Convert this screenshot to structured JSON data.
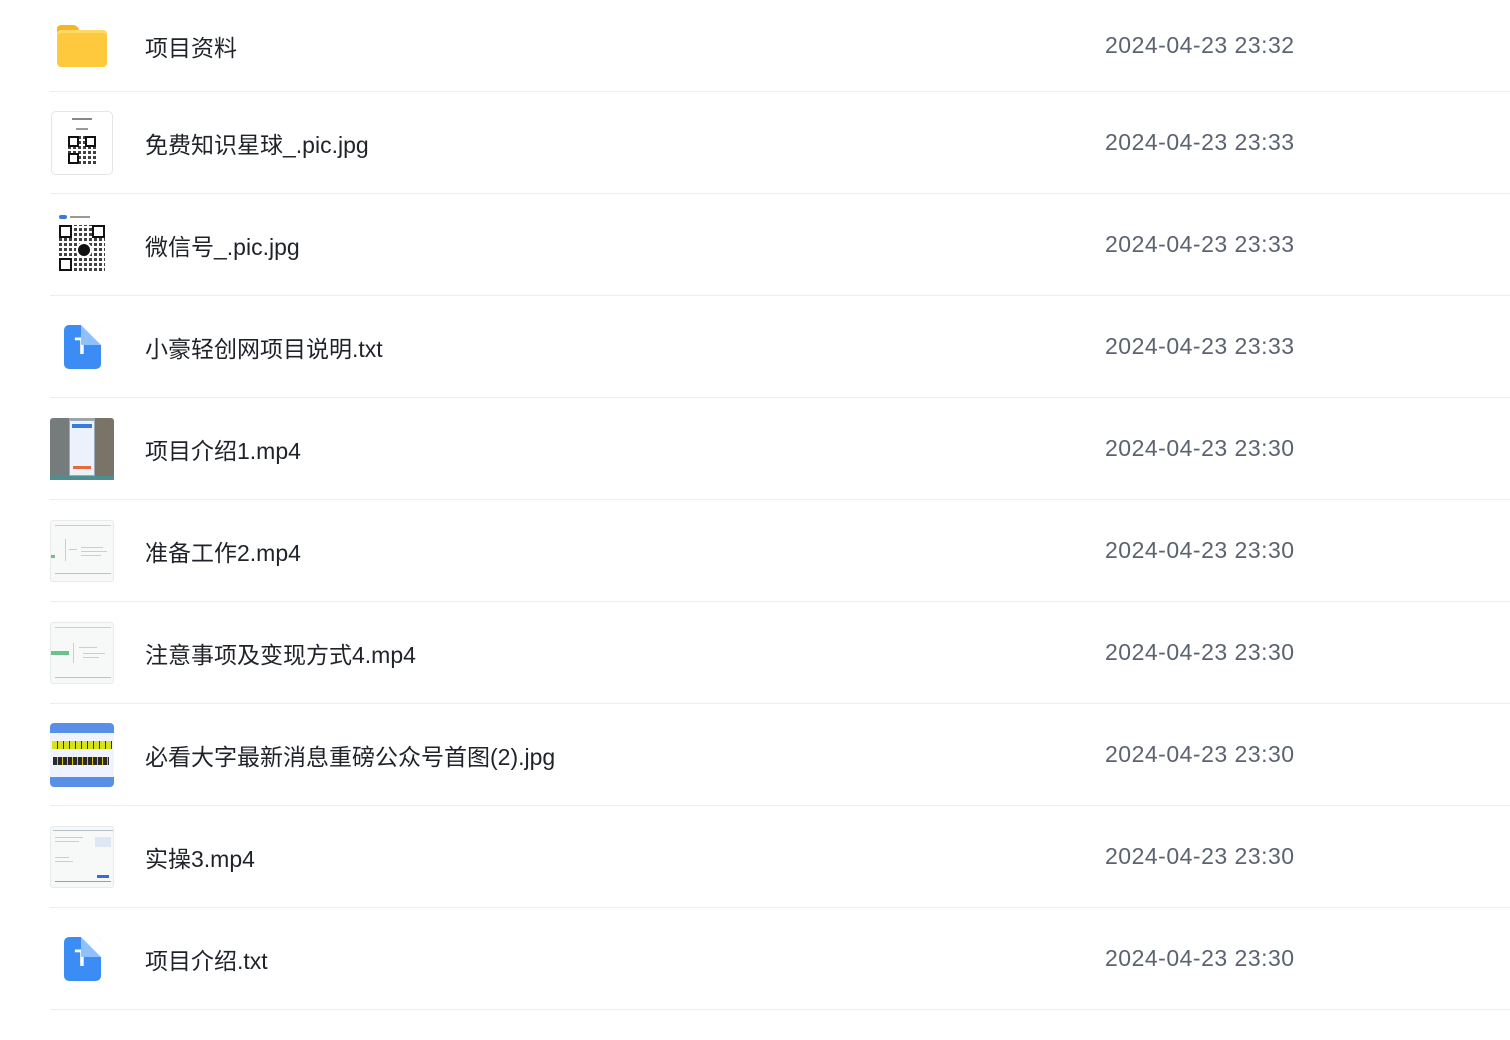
{
  "files": [
    {
      "name": "项目资料",
      "time": "2024-04-23 23:32",
      "icon": "folder-icon"
    },
    {
      "name": "免费知识星球_.pic.jpg",
      "time": "2024-04-23 23:33",
      "icon": "qr-image-thumbnail"
    },
    {
      "name": "微信号_.pic.jpg",
      "time": "2024-04-23 23:33",
      "icon": "qr-image-thumbnail"
    },
    {
      "name": "小豪轻创网项目说明.txt",
      "time": "2024-04-23 23:33",
      "icon": "text-file-icon"
    },
    {
      "name": "项目介绍1.mp4",
      "time": "2024-04-23 23:30",
      "icon": "video-thumbnail"
    },
    {
      "name": "准备工作2.mp4",
      "time": "2024-04-23 23:30",
      "icon": "video-thumbnail"
    },
    {
      "name": "注意事项及变现方式4.mp4",
      "time": "2024-04-23 23:30",
      "icon": "video-thumbnail"
    },
    {
      "name": "必看大字最新消息重磅公众号首图(2).jpg",
      "time": "2024-04-23 23:30",
      "icon": "image-thumbnail"
    },
    {
      "name": "实操3.mp4",
      "time": "2024-04-23 23:30",
      "icon": "video-thumbnail"
    },
    {
      "name": "项目介绍.txt",
      "time": "2024-04-23 23:30",
      "icon": "text-file-icon"
    }
  ],
  "txt_icon_letter": "T",
  "colors": {
    "folder": "#ffc93d",
    "txt_icon": "#3b8cf5",
    "name_text": "#1f2329",
    "time_text": "#5c6370",
    "divider": "#eceef2"
  }
}
